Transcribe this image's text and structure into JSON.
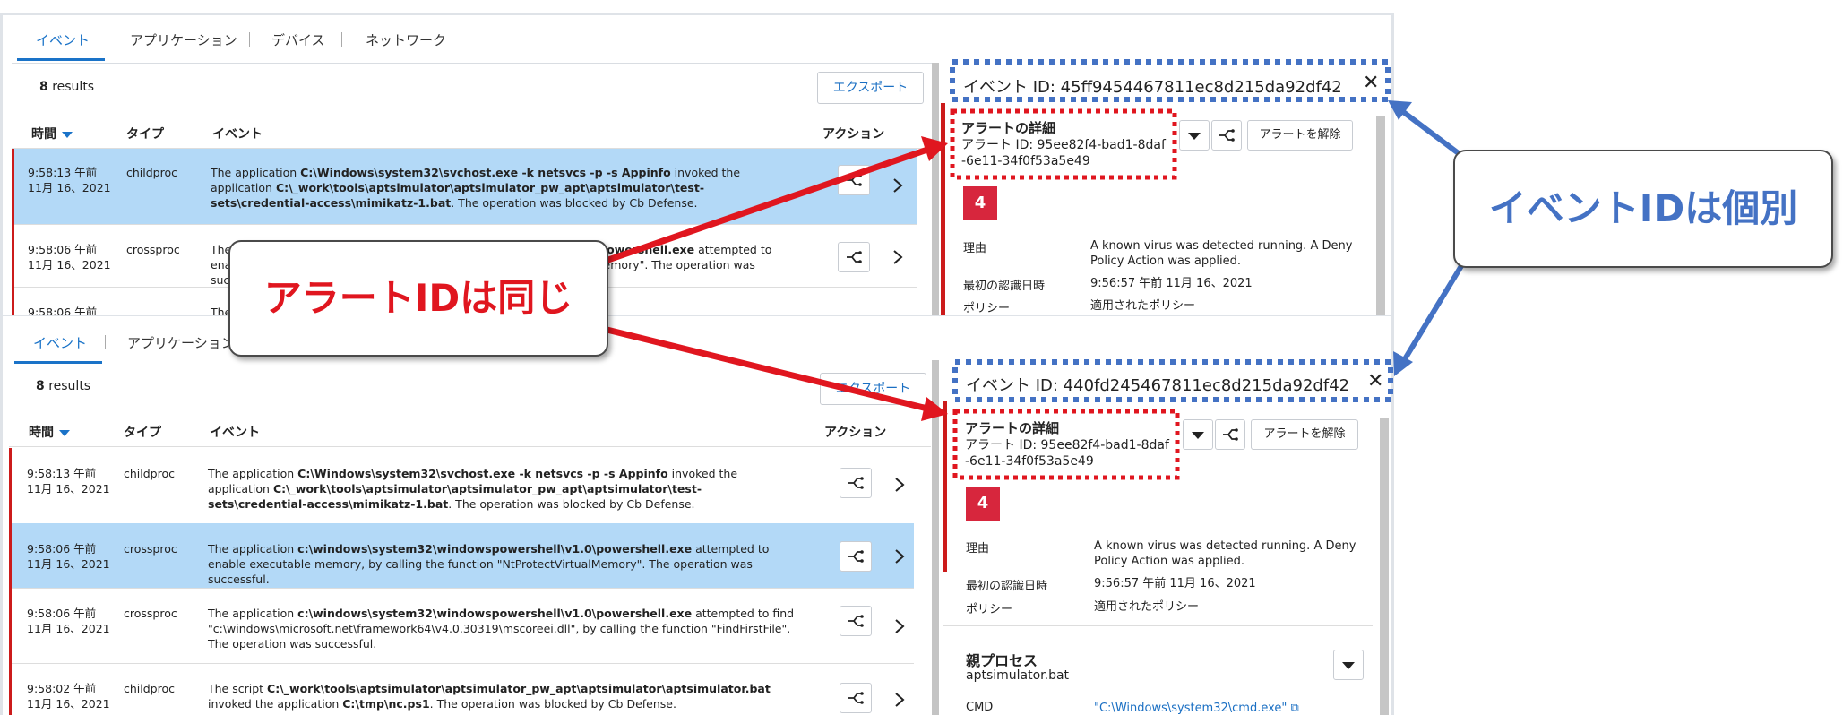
{
  "tabs": [
    "イベント",
    "アプリケーション",
    "デバイス",
    "ネットワーク"
  ],
  "results_count": "8",
  "results_label": "results",
  "export_label": "エクスポート",
  "columns": {
    "time": "時間",
    "type": "タイプ",
    "event": "イベント",
    "action": "アクション"
  },
  "rows": [
    {
      "time1": "9:58:13 午前",
      "time2": "11月 16、2021",
      "type": "childproc",
      "ev": [
        "The application ",
        "C:\\Windows\\system32\\svchost.exe -k netsvcs -p -s Appinfo",
        " invoked the application ",
        "C:\\_work\\tools\\aptsimulator\\aptsimulator_pw_apt\\aptsimulator\\test-sets\\credential-access\\mimikatz-1.bat",
        ". The operation was blocked by Cb Defense."
      ]
    },
    {
      "time1": "9:58:06 午前",
      "time2": "11月 16、2021",
      "type": "crossproc",
      "ev": [
        "The application ",
        "c:\\windows\\system32\\windowspowershell\\v1.0\\powershell.exe",
        " attempted to enable executable memory, by calling the function \"NtProtectVirtualMemory\". The operation was successful."
      ]
    },
    {
      "time1": "9:58:06 午前",
      "time2": "11月 16、2021",
      "type": "crossproc",
      "ev": [
        "The application ",
        "c:\\windows\\system32\\windowspowershell\\v1.0\\powershell.exe",
        " attempted to find \"c:\\windows\\microsoft.net\\framework64\\v4.0.30319\\mscoreei.dll\", by calling the function \"FindFirstFile\". The operation was successful."
      ]
    },
    {
      "time1": "9:58:02 午前",
      "time2": "11月 16、2021",
      "type": "childproc",
      "ev": [
        "The script ",
        "C:\\_work\\tools\\aptsimulator\\aptsimulator_pw_apt\\aptsimulator\\aptsimulator.bat",
        " invoked the application ",
        "C:\\tmp\\nc.ps1",
        ". The operation was blocked by Cb Defense."
      ]
    }
  ],
  "top_event_id": "イベント ID: 45ff9454467811ec8d215da92df42",
  "bottom_event_id": "イベント ID: 440fd245467811ec8d215da92df42",
  "alert": {
    "title": "アラートの詳細",
    "id_line1": "アラート ID: 95ee82f4-bad1-8daf",
    "id_line2": "-6e11-34f0f53a5e49",
    "dismiss_label": "アラートを解除",
    "severity": "4",
    "reason_label": "理由",
    "reason_line1": "A known virus was detected running. A Deny",
    "reason_line2": "Policy Action was applied.",
    "first_seen_label": "最初の認識日時",
    "first_seen": "9:56:57 午前 11月 16、2021",
    "policy_label": "ポリシー",
    "policy": "適用されたポリシー"
  },
  "parent": {
    "title": "親プロセス",
    "name": "aptsimulator.bat",
    "cmd_label": "CMD",
    "cmd": "\"C:\\Windows\\system32\\cmd.exe\""
  },
  "callouts": {
    "alert_same": "アラートIDは同じ",
    "event_individual": "イベントIDは個別"
  },
  "colors": {
    "accent": "#1a73c8",
    "selected_row": "#b3d9f7",
    "alert_red": "#cc1b1b",
    "callout_blue": "#4472c4"
  }
}
